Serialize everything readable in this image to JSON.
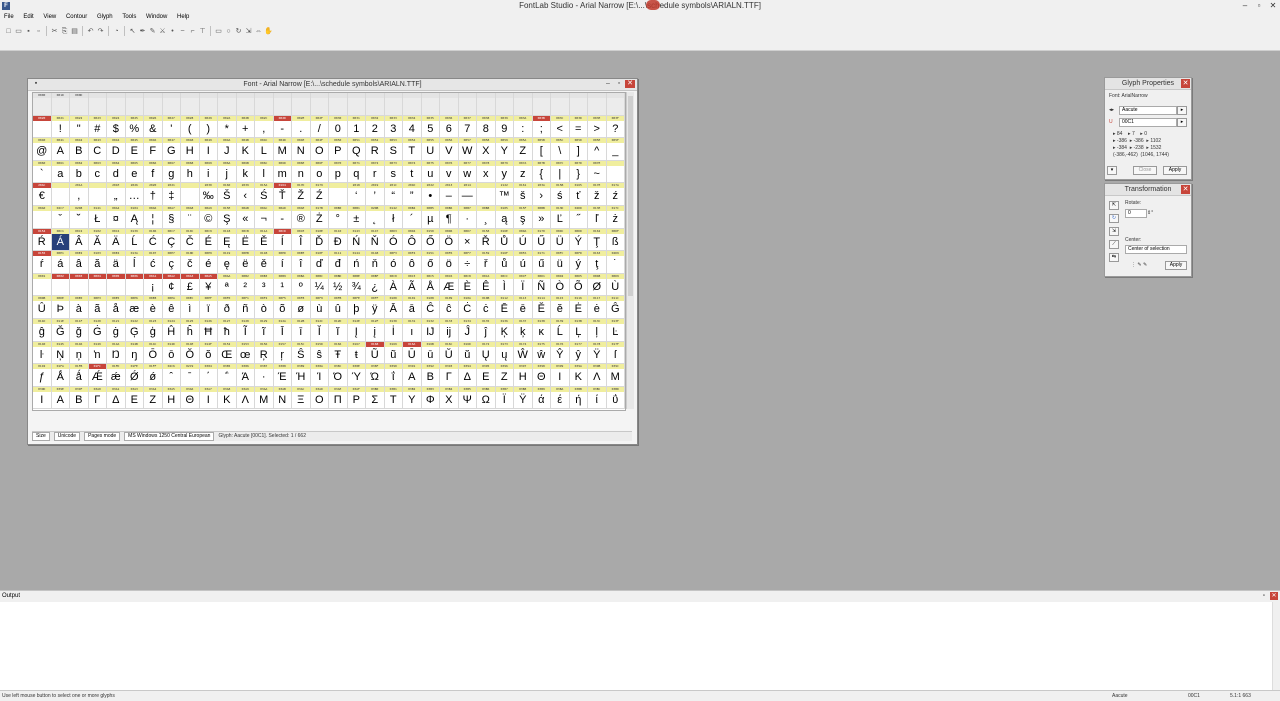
{
  "app": {
    "title": "FontLab Studio - Arial Narrow [E:\\...\\schedule symbols\\ARIALN.TTF]",
    "icon_label": "F",
    "window_controls": {
      "min": "–",
      "max": "▫",
      "close": "✕"
    }
  },
  "menu": {
    "items": [
      "File",
      "Edit",
      "View",
      "Contour",
      "Glyph",
      "Tools",
      "Window",
      "Help"
    ]
  },
  "toolbar": {
    "icons": [
      "new-icon",
      "open-icon",
      "save-icon",
      "save-all-icon",
      "cut-icon",
      "copy-icon",
      "paste-icon",
      "undo-icon",
      "redo-icon",
      "fill-icon",
      "pointer-icon",
      "pen-icon",
      "brush-icon",
      "knife-icon",
      "node-icon",
      "curve-icon",
      "corner-icon",
      "tangent-icon",
      "rect-icon",
      "ellipse-icon",
      "rotate-icon",
      "scale-icon",
      "measure-icon",
      "hand-icon"
    ]
  },
  "font_window": {
    "title": "Font - Arial Narrow [E:\\...\\schedule symbols\\ARIALN.TTF]",
    "status": {
      "size": "Size",
      "names": "Unicode",
      "mode": "Pages mode",
      "codepage": "MS Windows 1250 Central European",
      "info": "Glyph: Aacute [00C1]. Selected: 1 / 662"
    }
  },
  "glyph_grid": {
    "rows": [
      {
        "hdr": [
          "0000",
          "001D",
          "000D",
          "",
          "",
          "",
          "",
          "",
          "",
          "",
          "",
          "",
          "",
          "",
          "",
          "",
          "",
          "",
          "",
          "",
          "",
          "",
          "",
          "",
          "",
          "",
          "",
          "",
          "",
          "",
          "",
          ""
        ],
        "g": [
          "",
          "",
          "",
          "",
          "",
          "",
          "",
          "",
          "",
          "",
          "",
          "",
          "",
          "",
          "",
          "",
          "",
          "",
          "",
          "",
          "",
          "",
          "",
          "",
          "",
          "",
          "",
          "",
          "",
          "",
          "",
          ""
        ],
        "empty": true
      },
      {
        "hdr": [
          "0020",
          "0021",
          "0022",
          "0023",
          "0024",
          "0025",
          "0026",
          "0027",
          "0028",
          "0029",
          "002A",
          "002B",
          "002C",
          "002D",
          "002E",
          "002F",
          "0030",
          "0031",
          "0032",
          "0033",
          "0034",
          "0035",
          "0036",
          "0037",
          "0038",
          "0039",
          "003A",
          "003B",
          "003C",
          "003D",
          "003E",
          "003F"
        ],
        "g": [
          " ",
          "!",
          "\"",
          "#",
          "$",
          "%",
          "&",
          "'",
          "(",
          ")",
          "*",
          "+",
          ",",
          "-",
          ".",
          "/",
          "0",
          "1",
          "2",
          "3",
          "4",
          "5",
          "6",
          "7",
          "8",
          "9",
          ":",
          ";",
          "<",
          "=",
          ">",
          "?"
        ]
      },
      {
        "hdr": [
          "0040",
          "0041",
          "0042",
          "0043",
          "0044",
          "0045",
          "0046",
          "0047",
          "0048",
          "0049",
          "004A",
          "004B",
          "004C",
          "004D",
          "004E",
          "004F",
          "0050",
          "0051",
          "0052",
          "0053",
          "0054",
          "0055",
          "0056",
          "0057",
          "0058",
          "0059",
          "005A",
          "005B",
          "005C",
          "005D",
          "005E",
          "005F"
        ],
        "g": [
          "@",
          "A",
          "B",
          "C",
          "D",
          "E",
          "F",
          "G",
          "H",
          "I",
          "J",
          "K",
          "L",
          "M",
          "N",
          "O",
          "P",
          "Q",
          "R",
          "S",
          "T",
          "U",
          "V",
          "W",
          "X",
          "Y",
          "Z",
          "[",
          "\\",
          "]",
          "^",
          "_"
        ]
      },
      {
        "hdr": [
          "0060",
          "0061",
          "0062",
          "0063",
          "0064",
          "0065",
          "0066",
          "0067",
          "0068",
          "0069",
          "006A",
          "006B",
          "006C",
          "006D",
          "006E",
          "006F",
          "0070",
          "0071",
          "0072",
          "0073",
          "0074",
          "0075",
          "0076",
          "0077",
          "0078",
          "0079",
          "007A",
          "007B",
          "007C",
          "007D",
          "007E",
          ""
        ],
        "g": [
          "`",
          "a",
          "b",
          "c",
          "d",
          "e",
          "f",
          "g",
          "h",
          "i",
          "j",
          "k",
          "l",
          "m",
          "n",
          "o",
          "p",
          "q",
          "r",
          "s",
          "t",
          "u",
          "v",
          "w",
          "x",
          "y",
          "z",
          "{",
          "|",
          "}",
          "~",
          ""
        ]
      },
      {
        "hdr": [
          "20AC",
          "",
          "201A",
          "",
          "201E",
          "2026",
          "2020",
          "2021",
          "",
          "2030",
          "0160",
          "2039",
          "015A",
          "0164",
          "017D",
          "0179",
          "",
          "2018",
          "2019",
          "201C",
          "201D",
          "2022",
          "2013",
          "2014",
          "",
          "2122",
          "0161",
          "203A",
          "015B",
          "0165",
          "017E",
          "017A"
        ],
        "g": [
          "€",
          "",
          ",",
          "",
          "„",
          "…",
          "†",
          "‡",
          "",
          "‰",
          "Š",
          "‹",
          "Ś",
          "Ť",
          "Ž",
          "Ź",
          "",
          "‘",
          "’",
          "“",
          "”",
          "•",
          "–",
          "—",
          "",
          "™",
          "š",
          "›",
          "ś",
          "ť",
          "ž",
          "ź"
        ]
      },
      {
        "hdr": [
          "00A0",
          "02C7",
          "02D8",
          "0141",
          "00A4",
          "0104",
          "00A6",
          "00A7",
          "00A8",
          "00A9",
          "015E",
          "00AB",
          "00AC",
          "00AD",
          "00AE",
          "017B",
          "00B0",
          "00B1",
          "02DB",
          "0142",
          "00B4",
          "00B5",
          "00B6",
          "00B7",
          "00B8",
          "0105",
          "015F",
          "00BB",
          "013D",
          "02DD",
          "013E",
          "017C"
        ],
        "g": [
          " ",
          "ˇ",
          "˘",
          "Ł",
          "¤",
          "Ą",
          "¦",
          "§",
          "¨",
          "©",
          "Ş",
          "«",
          "¬",
          "-",
          "®",
          "Ż",
          "°",
          "±",
          "˛",
          "ł",
          "´",
          "µ",
          "¶",
          "·",
          "¸",
          "ą",
          "ş",
          "»",
          "Ľ",
          "˝",
          "ľ",
          "ż"
        ]
      },
      {
        "hdr": [
          "0154",
          "00C1",
          "00C2",
          "0102",
          "00C4",
          "0139",
          "0106",
          "00C7",
          "010C",
          "00C9",
          "0118",
          "00CB",
          "011A",
          "00CD",
          "00CE",
          "010E",
          "0110",
          "0143",
          "0147",
          "00D3",
          "00D4",
          "0150",
          "00D6",
          "00D7",
          "0158",
          "016E",
          "00DA",
          "0170",
          "00DC",
          "00DD",
          "0162",
          "00DF"
        ],
        "g": [
          "Ŕ",
          "Á",
          "Â",
          "Ă",
          "Ä",
          "Ĺ",
          "Ć",
          "Ç",
          "Č",
          "É",
          "Ę",
          "Ë",
          "Ě",
          "Í",
          "Î",
          "Ď",
          "Đ",
          "Ń",
          "Ň",
          "Ó",
          "Ô",
          "Ő",
          "Ö",
          "×",
          "Ř",
          "Ů",
          "Ú",
          "Ű",
          "Ü",
          "Ý",
          "Ţ",
          "ß"
        ]
      },
      {
        "hdr": [
          "0155",
          "00E1",
          "00E2",
          "0103",
          "00E4",
          "013A",
          "0107",
          "00E7",
          "010D",
          "00E9",
          "0119",
          "00EB",
          "011B",
          "00ED",
          "00EE",
          "010F",
          "0111",
          "0144",
          "0148",
          "00F3",
          "00F4",
          "0151",
          "00F6",
          "00F7",
          "0159",
          "016F",
          "00FA",
          "0171",
          "00FC",
          "00FD",
          "0163",
          "02D9"
        ],
        "g": [
          "ŕ",
          "á",
          "â",
          "ă",
          "ä",
          "ĺ",
          "ć",
          "ç",
          "č",
          "é",
          "ę",
          "ë",
          "ě",
          "í",
          "î",
          "ď",
          "đ",
          "ń",
          "ň",
          "ó",
          "ô",
          "ő",
          "ö",
          "÷",
          "ř",
          "ů",
          "ú",
          "ű",
          "ü",
          "ý",
          "ţ",
          "˙"
        ]
      },
      {
        "hdr": [
          "0001",
          "0002",
          "0003",
          "0004",
          "0005",
          "0006",
          "00A1",
          "00A2",
          "00A3",
          "00A5",
          "00AA",
          "00B2",
          "00B3",
          "00B9",
          "00BA",
          "00BC",
          "00BD",
          "00BE",
          "00BF",
          "00C0",
          "00C3",
          "00C5",
          "00C6",
          "00C8",
          "00CA",
          "00CC",
          "00CF",
          "00D1",
          "00D2",
          "00D5",
          "00D8",
          "00D9"
        ],
        "g": [
          "",
          "",
          "",
          "",
          "",
          "",
          "¡",
          "¢",
          "£",
          "¥",
          "ª",
          "²",
          "³",
          "¹",
          "º",
          "¼",
          "½",
          "¾",
          "¿",
          "À",
          "Ã",
          "Å",
          "Æ",
          "È",
          "Ê",
          "Ì",
          "Ï",
          "Ñ",
          "Ò",
          "Õ",
          "Ø",
          "Ù"
        ]
      },
      {
        "hdr": [
          "00DB",
          "00DE",
          "00E0",
          "00E3",
          "00E5",
          "00E6",
          "00E8",
          "00EA",
          "00EC",
          "00EF",
          "00F0",
          "00F1",
          "00F2",
          "00F5",
          "00F8",
          "00F9",
          "00FB",
          "00FE",
          "00FF",
          "0100",
          "0101",
          "0108",
          "0109",
          "010A",
          "010B",
          "0112",
          "0113",
          "0114",
          "0115",
          "0116",
          "0117",
          "011C"
        ],
        "g": [
          "Û",
          "Þ",
          "à",
          "ã",
          "å",
          "æ",
          "è",
          "ê",
          "ì",
          "ï",
          "ð",
          "ñ",
          "ò",
          "õ",
          "ø",
          "ù",
          "û",
          "þ",
          "ÿ",
          "Ā",
          "ā",
          "Ĉ",
          "ĉ",
          "Ċ",
          "ċ",
          "Ē",
          "ē",
          "Ĕ",
          "ĕ",
          "Ė",
          "ė",
          "Ĝ"
        ]
      },
      {
        "hdr": [
          "011D",
          "011E",
          "011F",
          "0120",
          "0121",
          "0122",
          "0123",
          "0124",
          "0125",
          "0126",
          "0127",
          "0128",
          "0129",
          "012A",
          "012B",
          "012C",
          "012D",
          "012E",
          "012F",
          "0130",
          "0131",
          "0132",
          "0133",
          "0134",
          "0135",
          "0136",
          "0137",
          "0138",
          "0139",
          "013B",
          "013C",
          "013F"
        ],
        "g": [
          "ĝ",
          "Ğ",
          "ğ",
          "Ġ",
          "ġ",
          "Ģ",
          "ģ",
          "Ĥ",
          "ĥ",
          "Ħ",
          "ħ",
          "Ĩ",
          "ĩ",
          "Ī",
          "ī",
          "Ĭ",
          "ĭ",
          "Į",
          "į",
          "İ",
          "ı",
          "Ĳ",
          "ĳ",
          "Ĵ",
          "ĵ",
          "Ķ",
          "ķ",
          "ĸ",
          "Ĺ",
          "Ļ",
          "ļ",
          "Ŀ"
        ]
      },
      {
        "hdr": [
          "0140",
          "0145",
          "0146",
          "0149",
          "014A",
          "014B",
          "014C",
          "014D",
          "014E",
          "014F",
          "0152",
          "0153",
          "0156",
          "0157",
          "015C",
          "015D",
          "0166",
          "0167",
          "0168",
          "0169",
          "016A",
          "016B",
          "016C",
          "016D",
          "0172",
          "0173",
          "0174",
          "0175",
          "0176",
          "0177",
          "0178",
          "017F"
        ],
        "g": [
          "ŀ",
          "Ņ",
          "ņ",
          "ŉ",
          "Ŋ",
          "ŋ",
          "Ō",
          "ō",
          "Ŏ",
          "ŏ",
          "Œ",
          "œ",
          "Ŗ",
          "ŗ",
          "Ŝ",
          "ŝ",
          "Ŧ",
          "ŧ",
          "Ũ",
          "ũ",
          "Ū",
          "ū",
          "Ŭ",
          "ŭ",
          "Ų",
          "ų",
          "Ŵ",
          "ŵ",
          "Ŷ",
          "ŷ",
          "Ÿ",
          "ſ"
        ]
      },
      {
        "hdr": [
          "0192",
          "01FA",
          "01FB",
          "01FC",
          "01FD",
          "01FE",
          "01FF",
          "02C6",
          "02C9",
          "0384",
          "0385",
          "0386",
          "0387",
          "0388",
          "0389",
          "038A",
          "038C",
          "038E",
          "038F",
          "0390",
          "0391",
          "0392",
          "0393",
          "0394",
          "0395",
          "0396",
          "0397",
          "0398",
          "0399",
          "039A",
          "039B",
          "039C"
        ],
        "g": [
          "ƒ",
          "Ǻ",
          "ǻ",
          "Ǽ",
          "ǽ",
          "Ǿ",
          "ǿ",
          "ˆ",
          "ˉ",
          "΄",
          "΅",
          "Ά",
          "·",
          "Έ",
          "Ή",
          "Ί",
          "Ό",
          "Ύ",
          "Ώ",
          "ΐ",
          "Α",
          "Β",
          "Γ",
          "Δ",
          "Ε",
          "Ζ",
          "Η",
          "Θ",
          "Ι",
          "Κ",
          "Λ",
          "Μ"
        ]
      },
      {
        "hdr": [
          "039D",
          "039E",
          "039F",
          "03A0",
          "03A1",
          "03A3",
          "03A4",
          "03A5",
          "03A6",
          "03A7",
          "03A8",
          "03A9",
          "03AA",
          "03AB",
          "03AC",
          "03AD",
          "03AE",
          "03AF",
          "03B0",
          "03B1",
          "03B2",
          "03B3",
          "03B4",
          "03B5",
          "03B6",
          "03B7",
          "03B8",
          "03B9",
          "03BA",
          "03BB",
          "03BC",
          "03BD"
        ],
        "g": [
          "Ι",
          "Α",
          "Β",
          "Γ",
          "Δ",
          "Ε",
          "Ζ",
          "Η",
          "Θ",
          "Ι",
          "Κ",
          "Λ",
          "Μ",
          "Ν",
          "Ξ",
          "Ο",
          "Π",
          "Ρ",
          "Σ",
          "Τ",
          "Υ",
          "Φ",
          "Χ",
          "Ψ",
          "Ω",
          "Ϊ",
          "Ϋ",
          "ά",
          "έ",
          "ή",
          "ί",
          "ΰ"
        ]
      }
    ]
  },
  "glyph_properties": {
    "title": "Glyph Properties",
    "font_label": "Font: ArialNarrow",
    "glyph_name": "Aacute",
    "glyph_code": "00C1",
    "metrics": [
      "84",
      "7",
      "0",
      "-386",
      "-386",
      "1102",
      "-384",
      "-238",
      "1532"
    ],
    "bbox": "(-386,-462)",
    "bbox2": "(1046, 1744)",
    "close_btn": "Close",
    "apply_btn": "Apply"
  },
  "transformation": {
    "title": "Transformation",
    "rotate_label": "Rotate:",
    "rotate_value": "0",
    "center_label": "Center:",
    "center_value": "Center of selection",
    "apply_btn": "Apply"
  },
  "output": {
    "title": "Output"
  },
  "statusbar": {
    "hint": "Use left mouse button to select one or more glyphs",
    "glyph": "Aacute",
    "code": "00C1",
    "zoom": "5.1:1 663"
  }
}
